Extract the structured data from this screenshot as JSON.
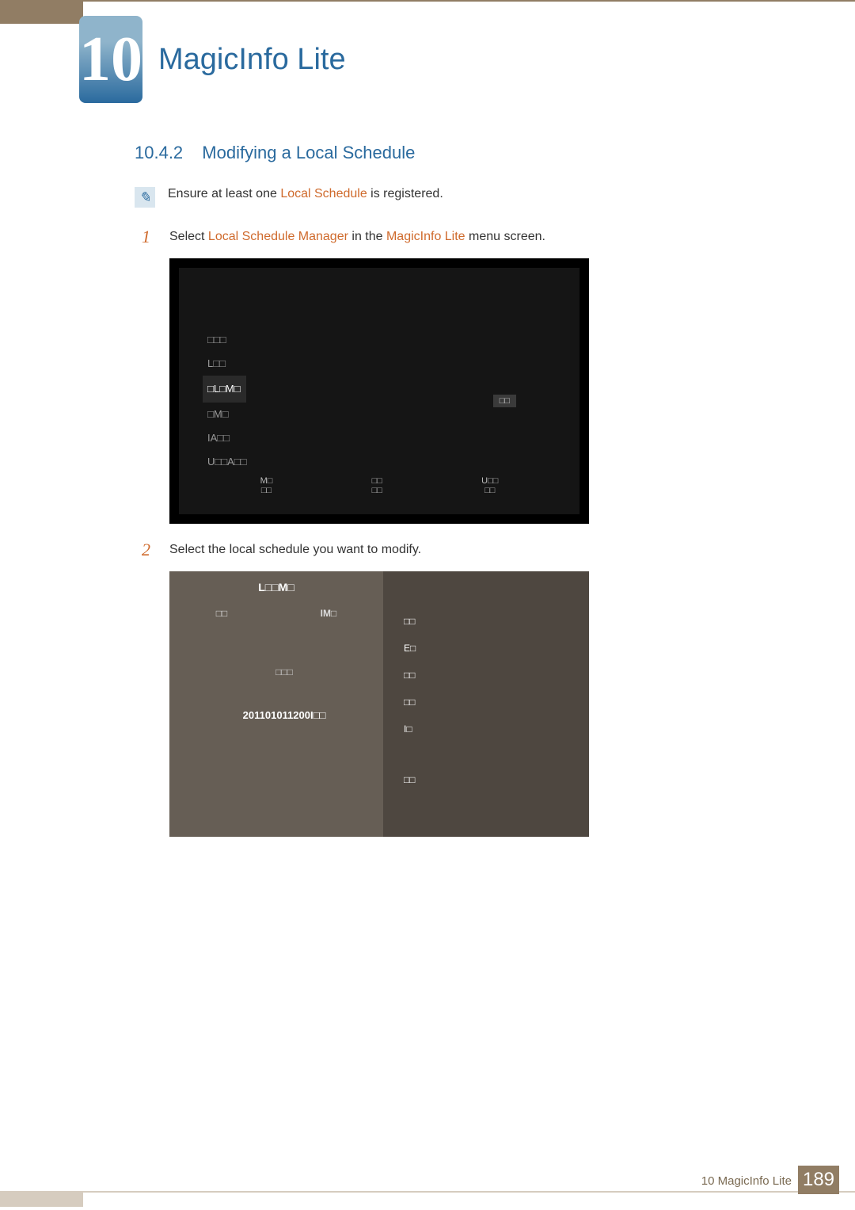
{
  "chapter": {
    "number": "10",
    "title": "MagicInfo Lite"
  },
  "section": {
    "number": "10.4.2",
    "title": "Modifying a Local Schedule"
  },
  "noteIcon": "✎",
  "note": {
    "pre": "Ensure at least one ",
    "em": "Local Schedule",
    "post": " is registered."
  },
  "steps": {
    "s1": {
      "num": "1",
      "t1": "Select ",
      "t2": "Local Schedule Manager",
      "t3": " in the ",
      "t4": "MagicInfo Lite",
      "t5": " menu screen."
    },
    "s2": {
      "num": "2",
      "text": "Select the local schedule you want to modify."
    }
  },
  "shot1": {
    "menu": [
      "□□□",
      "L□□",
      "□L□M□",
      "□M□",
      "IA□□",
      "U□□A□□"
    ],
    "rightLabel": "□□",
    "cols": {
      "c1a": "M□",
      "c1b": "□□",
      "c2a": "□□",
      "c2b": "□□",
      "c3a": "U□□",
      "c3b": "□□"
    }
  },
  "shot2": {
    "title": "L□□M□",
    "tabs": {
      "left": "□□",
      "right": "IM□"
    },
    "leftItemTop": "□□□",
    "leftItemName": "201101011200I□□",
    "list": [
      "□□",
      "E□",
      "□□",
      "□□",
      "I□",
      "□□"
    ]
  },
  "footer": {
    "chapter": "10 MagicInfo Lite",
    "page": "189"
  }
}
